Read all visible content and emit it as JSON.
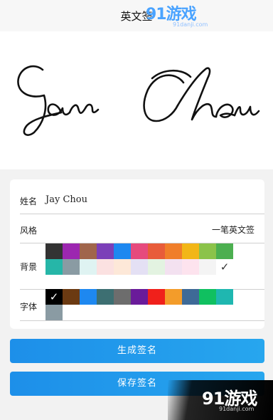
{
  "header": {
    "title": "英文签"
  },
  "watermark": {
    "brand": "91游戏",
    "site": "91danji.com"
  },
  "preview": {
    "signature_text": "Jay Chou"
  },
  "form": {
    "name_label": "姓名",
    "name_value": "Jay Chou",
    "style_label": "风格",
    "style_value": "一笔英文签",
    "background_label": "背景",
    "font_label": "字体"
  },
  "background_colors": [
    [
      "#333333",
      "#9c27b0",
      "#a0654b",
      "#7b3fb8",
      "#1e88f0",
      "#e64a7d",
      "#e85c3a",
      "#f07e2a",
      "#f2b617",
      "#8bc34a",
      "#4caf50"
    ],
    [
      "#26b6a8",
      "#8a9ba3",
      "#dff3f2",
      "#fbe1e1",
      "#fde8d8",
      "#e4e0f4",
      "#e3f3e1",
      "#f3e1f0",
      "#fde3ee",
      "#f4f4f4",
      "#ffffff"
    ]
  ],
  "background_selected": "#ffffff",
  "font_colors": [
    [
      "#000000",
      "#6b3a12",
      "#1e88f0",
      "#3d6f72",
      "#6d6d6d",
      "#6a1b9a",
      "#f0201b",
      "#f39c2a",
      "#3e6a97",
      "#10c060",
      "#1fb7b0"
    ],
    [
      "#8a9ba3"
    ]
  ],
  "font_selected": "#000000",
  "buttons": {
    "generate": "生成签名",
    "save": "保存签名"
  }
}
